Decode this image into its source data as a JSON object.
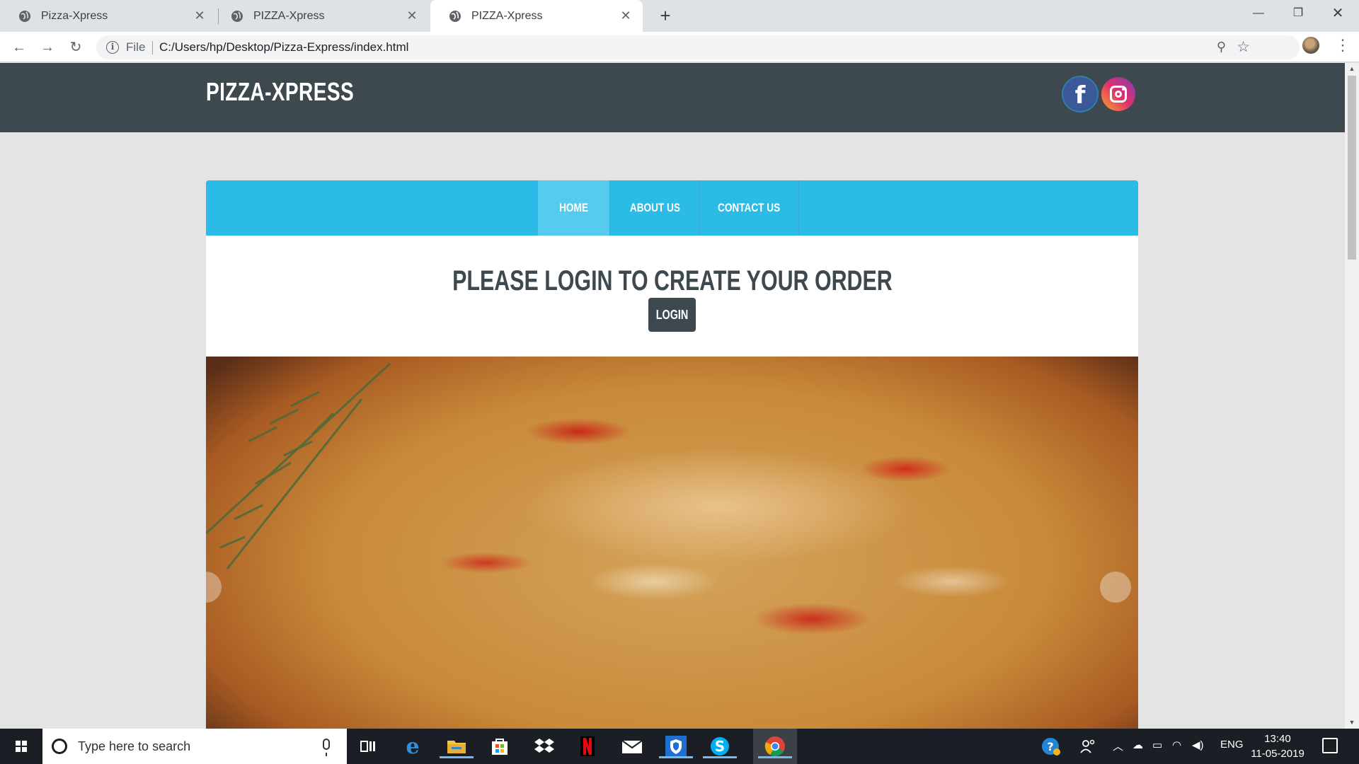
{
  "browser": {
    "tabs": [
      {
        "title": "Pizza-Xpress",
        "active": false
      },
      {
        "title": "PIZZA-Xpress",
        "active": false
      },
      {
        "title": "PIZZA-Xpress",
        "active": true
      }
    ],
    "address": {
      "scheme_label": "File",
      "url": "C:/Users/hp/Desktop/Pizza-Express/index.html"
    },
    "icons": [
      "back-icon",
      "forward-icon",
      "reload-icon",
      "info-icon",
      "zoom-icon",
      "star-icon",
      "kebab-menu-icon"
    ]
  },
  "site": {
    "brand": "PIZZA-XPRESS",
    "nav": [
      {
        "label": "HOME",
        "active": true
      },
      {
        "label": "ABOUT US",
        "active": false
      },
      {
        "label": "CONTACT US",
        "active": false
      }
    ],
    "headline": "PLEASE LOGIN TO CREATE YOUR ORDER",
    "login_label": "LOGIN",
    "colors": {
      "header": "#3e484f",
      "nav": "#2cbbe7",
      "nav_active": "#55cbee",
      "page_bg": "#e4e4e4"
    }
  },
  "taskbar": {
    "search_placeholder": "Type here to search",
    "apps": [
      "task-view-icon",
      "edge-icon",
      "file-explorer-icon",
      "store-icon",
      "dropbox-icon",
      "netflix-icon",
      "mail-icon",
      "security-icon",
      "skype-icon",
      "chrome-icon"
    ],
    "language": "ENG",
    "time": "13:40",
    "date": "11-05-2019"
  }
}
